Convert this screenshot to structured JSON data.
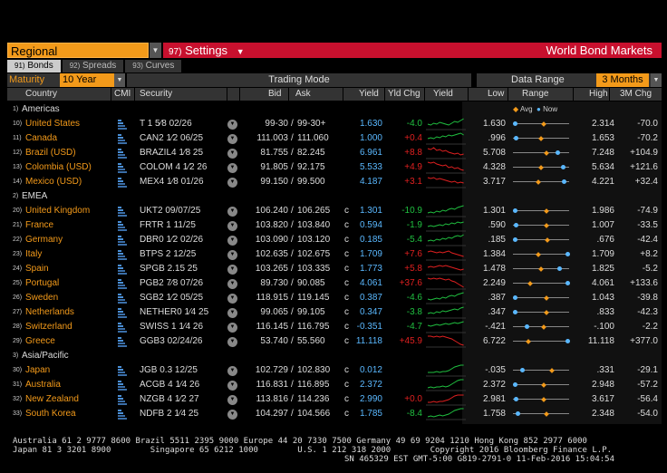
{
  "topbar": {
    "region": "Regional",
    "settings_num": "97)",
    "settings_label": "Settings",
    "title": "World Bond Markets"
  },
  "tabs": [
    {
      "num": "91)",
      "label": "Bonds"
    },
    {
      "num": "92)",
      "label": "Spreads"
    },
    {
      "num": "93)",
      "label": "Curves"
    }
  ],
  "moderow": {
    "maturity_label": "Maturity",
    "maturity_value": "10 Year",
    "trading_mode": "Trading Mode",
    "data_range": "Data Range",
    "range_value": "3 Months"
  },
  "headers": {
    "country": "Country",
    "cmi": "CMI",
    "security": "Security",
    "bid": "Bid",
    "ask": "Ask",
    "yield": "Yield",
    "yldchg": "Yld Chg",
    "yield_chart": "Yield",
    "low": "Low",
    "range": "Range",
    "high": "High",
    "chg3m": "3M Chg"
  },
  "legend": {
    "avg": "Avg",
    "now": "Now"
  },
  "colors": {
    "accent": "#f39a1a",
    "settings_bar": "#c8102e",
    "up": "#e02020",
    "down": "#20c040",
    "now_marker": "#5ab8ff"
  },
  "groups": {
    "americas": {
      "num": "1)",
      "label": "Americas"
    },
    "emea": {
      "num": "2)",
      "label": "EMEA"
    },
    "asia": {
      "num": "3)",
      "label": "Asia/Pacific"
    }
  },
  "rows": [
    {
      "num": "10)",
      "country": "United States",
      "security": "T 1 5⁄8 02/26",
      "bid": "99-30",
      "ask": "99-30+",
      "c": "",
      "yield": "1.630",
      "chg": "-4.0",
      "low": "1.630",
      "high": "2.314",
      "chg3m": "-70.0",
      "now": 0.0,
      "avg": 0.55,
      "spark": [
        6,
        5,
        7,
        6,
        8,
        7,
        6,
        5,
        7,
        9,
        8,
        10,
        12
      ],
      "sparkc": "neg"
    },
    {
      "num": "11)",
      "country": "Canada",
      "security": "CAN2 1⁄2 06/25",
      "bid": "111.003",
      "ask": "111.060",
      "c": "",
      "yield": "1.000",
      "chg": "+0.4",
      "low": ".996",
      "high": "1.653",
      "chg3m": "-70.2",
      "now": 0.01,
      "avg": 0.5,
      "spark": [
        6,
        7,
        6,
        8,
        7,
        9,
        8,
        10,
        9,
        10,
        11,
        12,
        10
      ],
      "sparkc": "neg"
    },
    {
      "num": "12)",
      "country": "Brazil (USD)",
      "security": "BRAZIL4 1⁄8 25",
      "bid": "81.755",
      "ask": "82.245",
      "c": "",
      "yield": "6.961",
      "chg": "+8.8",
      "low": "5.708",
      "high": "7.248",
      "chg3m": "+104.9",
      "now": 0.81,
      "avg": 0.6,
      "spark": [
        11,
        10,
        12,
        9,
        10,
        8,
        9,
        7,
        6,
        5,
        6,
        4,
        5
      ],
      "sparkc": "pos"
    },
    {
      "num": "13)",
      "country": "Colombia (USD)",
      "security": "COLOM 4 1⁄2 26",
      "bid": "91.805",
      "ask": "92.175",
      "c": "",
      "yield": "5.533",
      "chg": "+4.9",
      "low": "4.328",
      "high": "5.634",
      "chg3m": "+121.6",
      "now": 0.92,
      "avg": 0.5,
      "spark": [
        12,
        11,
        12,
        10,
        9,
        8,
        9,
        6,
        7,
        5,
        6,
        4,
        3
      ],
      "sparkc": "pos"
    },
    {
      "num": "14)",
      "country": "Mexico (USD)",
      "security": "MEX4 1⁄8 01/26",
      "bid": "99.150",
      "ask": "99.500",
      "c": "",
      "yield": "4.187",
      "chg": "+3.1",
      "low": "3.717",
      "high": "4.221",
      "chg3m": "+32.4",
      "now": 0.93,
      "avg": 0.45,
      "spark": [
        11,
        10,
        11,
        9,
        10,
        9,
        8,
        7,
        6,
        7,
        5,
        6,
        5
      ],
      "sparkc": "pos"
    },
    {
      "num": "20)",
      "country": "United Kingdom",
      "security": "UKT2 09/07/25",
      "bid": "106.240",
      "ask": "106.265",
      "c": "c",
      "yield": "1.301",
      "chg": "-10.9",
      "low": "1.301",
      "high": "1.986",
      "chg3m": "-74.9",
      "now": 0.0,
      "avg": 0.6,
      "spark": [
        4,
        5,
        4,
        6,
        5,
        7,
        6,
        8,
        9,
        8,
        10,
        11,
        12
      ],
      "sparkc": "neg"
    },
    {
      "num": "21)",
      "country": "France",
      "security": "FRTR 1 11/25",
      "bid": "103.820",
      "ask": "103.840",
      "c": "c",
      "yield": "0.594",
      "chg": "-1.9",
      "low": ".590",
      "high": "1.007",
      "chg3m": "-33.5",
      "now": 0.01,
      "avg": 0.6,
      "spark": [
        5,
        6,
        5,
        6,
        7,
        6,
        8,
        7,
        9,
        8,
        10,
        9,
        10
      ],
      "sparkc": "neg"
    },
    {
      "num": "22)",
      "country": "Germany",
      "security": "DBR0 1⁄2 02/26",
      "bid": "103.090",
      "ask": "103.120",
      "c": "c",
      "yield": "0.185",
      "chg": "-5.4",
      "low": ".185",
      "high": ".676",
      "chg3m": "-42.4",
      "now": 0.0,
      "avg": 0.62,
      "spark": [
        5,
        6,
        5,
        7,
        6,
        8,
        7,
        9,
        8,
        10,
        11,
        10,
        12
      ],
      "sparkc": "neg"
    },
    {
      "num": "23)",
      "country": "Italy",
      "security": "BTPS 2 12/25",
      "bid": "102.635",
      "ask": "102.675",
      "c": "c",
      "yield": "1.709",
      "chg": "+7.6",
      "low": "1.384",
      "high": "1.709",
      "chg3m": "+8.2",
      "now": 1.0,
      "avg": 0.45,
      "spark": [
        9,
        10,
        9,
        8,
        9,
        8,
        9,
        10,
        8,
        7,
        6,
        5,
        4
      ],
      "sparkc": "pos"
    },
    {
      "num": "24)",
      "country": "Spain",
      "security": "SPGB 2.15 25",
      "bid": "103.265",
      "ask": "103.335",
      "c": "c",
      "yield": "1.773",
      "chg": "+5.8",
      "low": "1.478",
      "high": "1.825",
      "chg3m": "-5.2",
      "now": 0.85,
      "avg": 0.5,
      "spark": [
        8,
        9,
        8,
        9,
        10,
        9,
        10,
        9,
        8,
        7,
        6,
        5,
        6
      ],
      "sparkc": "pos"
    },
    {
      "num": "25)",
      "country": "Portugal",
      "security": "PGB2 7⁄8 07/26",
      "bid": "89.730",
      "ask": "90.085",
      "c": "c",
      "yield": "4.061",
      "chg": "+37.6",
      "low": "2.249",
      "high": "4.061",
      "chg3m": "+133.6",
      "now": 1.0,
      "avg": 0.3,
      "spark": [
        12,
        11,
        12,
        11,
        12,
        11,
        10,
        11,
        9,
        8,
        6,
        4,
        2
      ],
      "sparkc": "pos"
    },
    {
      "num": "26)",
      "country": "Sweden",
      "security": "SGB2 1⁄2 05/25",
      "bid": "118.915",
      "ask": "119.145",
      "c": "c",
      "yield": "0.387",
      "chg": "-4.6",
      "low": ".387",
      "high": "1.043",
      "chg3m": "-39.8",
      "now": 0.0,
      "avg": 0.6,
      "spark": [
        5,
        4,
        5,
        6,
        5,
        7,
        6,
        8,
        9,
        8,
        10,
        11,
        12
      ],
      "sparkc": "neg"
    },
    {
      "num": "27)",
      "country": "Netherlands",
      "security": "NETHER0 1⁄4 25",
      "bid": "99.065",
      "ask": "99.105",
      "c": "c",
      "yield": "0.347",
      "chg": "-3.8",
      "low": ".347",
      "high": ".833",
      "chg3m": "-42.3",
      "now": 0.0,
      "avg": 0.6,
      "spark": [
        5,
        6,
        5,
        7,
        6,
        8,
        7,
        8,
        9,
        10,
        9,
        11,
        12
      ],
      "sparkc": "neg"
    },
    {
      "num": "28)",
      "country": "Switzerland",
      "security": "SWISS 1 1⁄4 26",
      "bid": "116.145",
      "ask": "116.795",
      "c": "c",
      "yield": "-0.351",
      "chg": "-4.7",
      "low": "-.421",
      "high": "-.100",
      "chg3m": "-2.2",
      "now": 0.22,
      "avg": 0.55,
      "spark": [
        8,
        7,
        8,
        9,
        8,
        9,
        10,
        9,
        10,
        11,
        10,
        11,
        12
      ],
      "sparkc": "neg"
    },
    {
      "num": "29)",
      "country": "Greece",
      "security": "GGB3 02/24/26",
      "bid": "53.740",
      "ask": "55.560",
      "c": "c",
      "yield": "11.118",
      "chg": "+45.9",
      "low": "6.722",
      "high": "11.118",
      "chg3m": "+377.0",
      "now": 1.0,
      "avg": 0.25,
      "spark": [
        12,
        12,
        11,
        12,
        11,
        12,
        11,
        10,
        9,
        7,
        5,
        3,
        2
      ],
      "sparkc": "pos"
    },
    {
      "num": "30)",
      "country": "Japan",
      "security": "JGB 0.3 12/25",
      "bid": "102.729",
      "ask": "102.830",
      "c": "c",
      "yield": "0.012",
      "chg": "",
      "low": "-.035",
      "high": ".331",
      "chg3m": "-29.1",
      "now": 0.13,
      "avg": 0.7,
      "spark": [
        4,
        4,
        4,
        5,
        4,
        5,
        5,
        6,
        8,
        10,
        11,
        12,
        12
      ],
      "sparkc": "neg"
    },
    {
      "num": "31)",
      "country": "Australia",
      "security": "ACGB 4 1⁄4 26",
      "bid": "116.831",
      "ask": "116.895",
      "c": "c",
      "yield": "2.372",
      "chg": "",
      "low": "2.372",
      "high": "2.948",
      "chg3m": "-57.2",
      "now": 0.0,
      "avg": 0.55,
      "spark": [
        3,
        4,
        3,
        4,
        4,
        5,
        4,
        5,
        7,
        9,
        11,
        12,
        12
      ],
      "sparkc": "neg"
    },
    {
      "num": "32)",
      "country": "New Zealand",
      "security": "NZGB 4 1⁄2 27",
      "bid": "113.816",
      "ask": "114.236",
      "c": "c",
      "yield": "2.990",
      "chg": "+0.0",
      "low": "2.981",
      "high": "3.617",
      "chg3m": "-56.4",
      "now": 0.01,
      "avg": 0.55,
      "spark": [
        3,
        3,
        4,
        3,
        4,
        4,
        5,
        6,
        8,
        10,
        11,
        11,
        11
      ],
      "sparkc": "pos"
    },
    {
      "num": "33)",
      "country": "South Korea",
      "security": "NDFB 2 1⁄4 25",
      "bid": "104.297",
      "ask": "104.566",
      "c": "c",
      "yield": "1.785",
      "chg": "-8.4",
      "low": "1.758",
      "high": "2.348",
      "chg3m": "-54.0",
      "now": 0.05,
      "avg": 0.6,
      "spark": [
        3,
        4,
        3,
        4,
        5,
        4,
        5,
        6,
        8,
        10,
        11,
        12,
        12
      ],
      "sparkc": "neg"
    }
  ],
  "footer": {
    "line1": "Australia 61 2 9777 8600 Brazil 5511 2395 9000 Europe 44 20 7330 7500 Germany 49 69 9204 1210 Hong Kong 852 2977 6000",
    "line2": "Japan 81 3 3201 8900        Singapore 65 6212 1000        U.S. 1 212 318 2000        Copyright 2016 Bloomberg Finance L.P.",
    "line3": "SN 465329 EST  GMT-5:00 G819-2791-0 11-Feb-2016 15:04:54"
  }
}
